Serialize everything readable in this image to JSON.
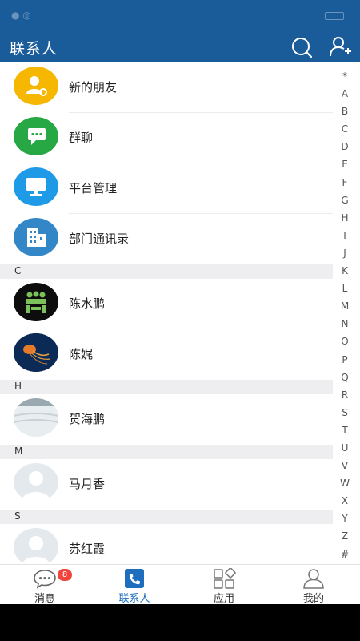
{
  "header": {
    "title": "联系人",
    "search_icon": "search-icon",
    "add_contact_icon": "add-contact-icon"
  },
  "fixed_items": [
    {
      "label": "新的朋友",
      "icon": "new-friend-icon",
      "color": "#f5b700"
    },
    {
      "label": "群聊",
      "icon": "group-chat-icon",
      "color": "#27a844"
    },
    {
      "label": "平台管理",
      "icon": "monitor-icon",
      "color": "#1e9ae6"
    },
    {
      "label": "部门通讯录",
      "icon": "building-icon",
      "color": "#3487c6"
    }
  ],
  "sections": [
    {
      "letter": "C",
      "contacts": [
        {
          "name": "陈水鹏"
        },
        {
          "name": "陈娓"
        }
      ]
    },
    {
      "letter": "H",
      "contacts": [
        {
          "name": "贺海鹏"
        }
      ]
    },
    {
      "letter": "M",
      "contacts": [
        {
          "name": "马月香"
        }
      ]
    },
    {
      "letter": "S",
      "contacts": [
        {
          "name": "苏红霞"
        }
      ]
    }
  ],
  "index_letters": [
    "*",
    "A",
    "B",
    "C",
    "D",
    "E",
    "F",
    "G",
    "H",
    "I",
    "J",
    "K",
    "L",
    "M",
    "N",
    "O",
    "P",
    "Q",
    "R",
    "S",
    "T",
    "U",
    "V",
    "W",
    "X",
    "Y",
    "Z",
    "#"
  ],
  "tabs": [
    {
      "label": "消息",
      "icon": "message-icon",
      "badge": "8",
      "active": false
    },
    {
      "label": "联系人",
      "icon": "contacts-icon",
      "active": true
    },
    {
      "label": "应用",
      "icon": "apps-icon",
      "active": false
    },
    {
      "label": "我的",
      "icon": "profile-icon",
      "active": false
    }
  ],
  "colors": {
    "primary": "#1a5b9a",
    "active_tab": "#1e6ebd",
    "badge": "#f2443e"
  }
}
